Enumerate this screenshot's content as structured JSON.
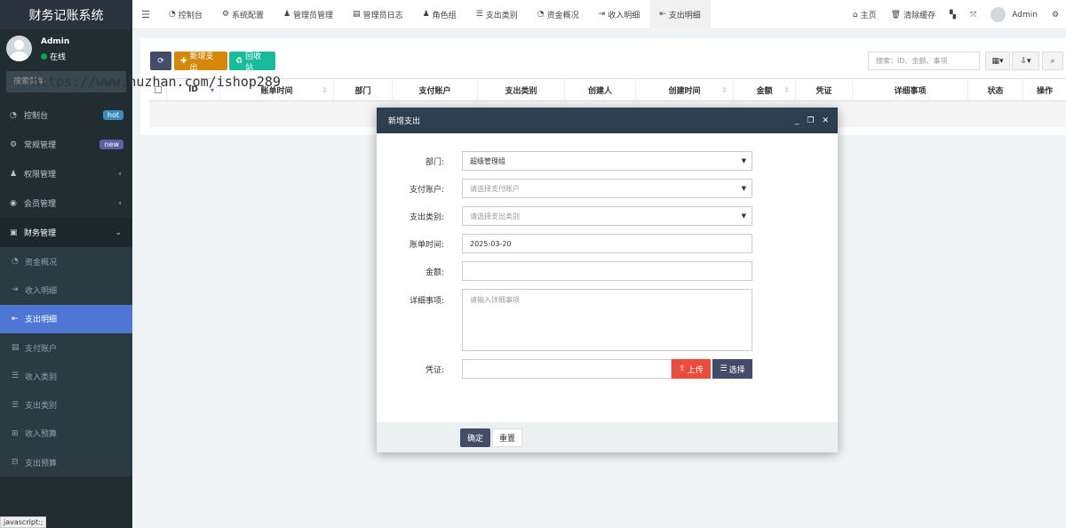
{
  "app": {
    "title": "财务记账系统"
  },
  "user": {
    "name": "Admin",
    "status": "在线"
  },
  "sidebar": {
    "search_placeholder": "搜索菜单",
    "items": [
      {
        "icon": "dashboard-icon",
        "glyph": "◔",
        "label": "控制台",
        "badge": "hot"
      },
      {
        "icon": "cogs-icon",
        "glyph": "⚙",
        "label": "常规管理",
        "badge": "new"
      },
      {
        "icon": "group-icon",
        "glyph": "♟",
        "label": "权限管理",
        "caret": "‹"
      },
      {
        "icon": "user-circle-icon",
        "glyph": "◉",
        "label": "会员管理",
        "caret": "‹"
      },
      {
        "icon": "money-icon",
        "glyph": "▣",
        "label": "财务管理",
        "caret": "⌄"
      }
    ],
    "subitems": [
      {
        "icon": "dashboard-icon",
        "glyph": "◔",
        "label": "资金概况"
      },
      {
        "icon": "sign-in-icon",
        "glyph": "⇥",
        "label": "收入明细"
      },
      {
        "icon": "sign-out-icon",
        "glyph": "⇤",
        "label": "支出明细"
      },
      {
        "icon": "address-book-icon",
        "glyph": "▤",
        "label": "支付账户"
      },
      {
        "icon": "list-icon",
        "glyph": "☰",
        "label": "收入类别"
      },
      {
        "icon": "list-icon",
        "glyph": "☰",
        "label": "支出类别"
      },
      {
        "icon": "budget-icon",
        "glyph": "⊞",
        "label": "收入预算"
      },
      {
        "icon": "budget-icon",
        "glyph": "⊟",
        "label": "支出预算"
      }
    ]
  },
  "watermark": "https://www.huzhan.com/ishop289",
  "status_bar": "javascript:;",
  "topnav": {
    "tabs": [
      {
        "icon": "dashboard-icon",
        "glyph": "◔",
        "label": "控制台"
      },
      {
        "icon": "cog-icon",
        "glyph": "⚙",
        "label": "系统配置"
      },
      {
        "icon": "user-icon",
        "glyph": "♟",
        "label": "管理员管理"
      },
      {
        "icon": "list-alt-icon",
        "glyph": "▤",
        "label": "管理员日志"
      },
      {
        "icon": "group-icon",
        "glyph": "♟",
        "label": "角色组"
      },
      {
        "icon": "list-icon",
        "glyph": "☰",
        "label": "支出类别"
      },
      {
        "icon": "dashboard-icon",
        "glyph": "◔",
        "label": "资金概况"
      },
      {
        "icon": "sign-in-icon",
        "glyph": "⇥",
        "label": "收入明细"
      },
      {
        "icon": "sign-out-icon",
        "glyph": "⇤",
        "label": "支出明细"
      }
    ],
    "right": {
      "home": "主页",
      "clear_cache": "清除缓存",
      "user": "Admin"
    }
  },
  "toolbar": {
    "add_label": "新增支出",
    "recycle_label": "回收站",
    "search_placeholder": "搜索：ID、金额、事项"
  },
  "table": {
    "columns": [
      "ID",
      "账单时间",
      "部门",
      "支付账户",
      "支出类别",
      "创建人",
      "创建时间",
      "金额",
      "凭证",
      "详细事项",
      "状态",
      "操作"
    ]
  },
  "modal": {
    "title": "新增支出",
    "fields": {
      "department": {
        "label": "部门:",
        "value": "超级管理组"
      },
      "account": {
        "label": "支付账户:",
        "placeholder": "请选择支付账户"
      },
      "category": {
        "label": "支出类别:",
        "placeholder": "请选择支出类别"
      },
      "bill_time": {
        "label": "账单时间:",
        "value": "2025-03-20"
      },
      "amount": {
        "label": "金额:",
        "value": ""
      },
      "details": {
        "label": "详细事项:",
        "placeholder": "请输入详细事项"
      },
      "voucher": {
        "label": "凭证:",
        "upload_label": "上传",
        "choose_label": "选择"
      }
    },
    "ok_label": "确定",
    "reset_label": "重置"
  },
  "colors": {
    "sidebar_bg": "#222d32",
    "active_item": "#4d76d5",
    "modal_header": "#2c3e50",
    "btn_add": "#d48806",
    "btn_recycle": "#18bc9c",
    "btn_upload": "#e74c3c"
  }
}
